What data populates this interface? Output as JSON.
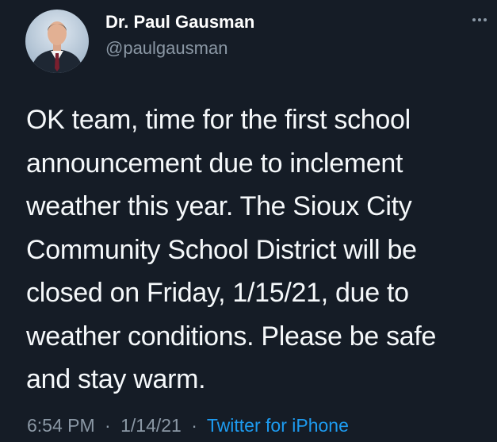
{
  "tweet": {
    "author": {
      "display_name": "Dr. Paul Gausman",
      "handle": "@paulgausman",
      "avatar_icon": "profile-photo-man-in-suit"
    },
    "more_icon": "more-options-icon",
    "text_lines": [
      "OK team, time for the first school",
      "announcement due to inclement",
      "weather this year. The Sioux City",
      "Community School District will be",
      "closed on Friday, 1/15/21, due to",
      "weather conditions. Please be safe",
      "and stay warm."
    ],
    "meta": {
      "time": "6:54 PM",
      "date": "1/14/21",
      "separator": "·",
      "source": "Twitter for iPhone"
    }
  },
  "colors": {
    "background": "#151c26",
    "text": "#f5f8fa",
    "secondary_text": "#8b98a5",
    "link": "#1d9bf0"
  }
}
